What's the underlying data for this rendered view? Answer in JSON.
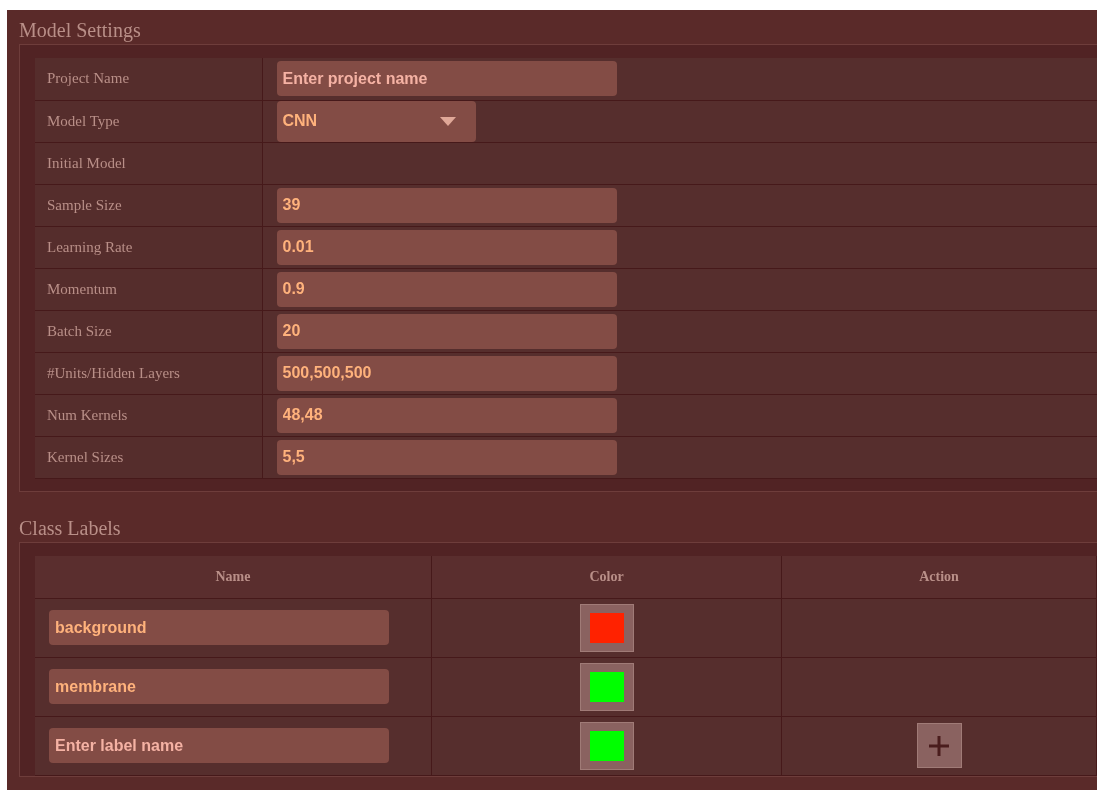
{
  "model_settings": {
    "title": "Model Settings",
    "fields": [
      {
        "label": "Project Name",
        "kind": "text",
        "placeholder": "Enter project name"
      },
      {
        "label": "Model Type",
        "kind": "select",
        "value": "CNN"
      },
      {
        "label": "Initial Model",
        "kind": "empty"
      },
      {
        "label": "Sample Size",
        "kind": "text",
        "value": "39"
      },
      {
        "label": "Learning Rate",
        "kind": "text",
        "value": "0.01"
      },
      {
        "label": "Momentum",
        "kind": "text",
        "value": "0.9"
      },
      {
        "label": "Batch Size",
        "kind": "text",
        "value": "20"
      },
      {
        "label": "#Units/Hidden Layers",
        "kind": "text",
        "value": "500,500,500"
      },
      {
        "label": "Num Kernels",
        "kind": "text",
        "value": "48,48"
      },
      {
        "label": "Kernel Sizes",
        "kind": "text",
        "value": "5,5"
      }
    ]
  },
  "class_labels": {
    "title": "Class Labels",
    "columns": [
      "Name",
      "Color",
      "Action"
    ],
    "rows": [
      {
        "value": "background",
        "color": "#ff2200"
      },
      {
        "value": "membrane",
        "color": "#00ff00"
      },
      {
        "placeholder": "Enter label name",
        "color": "#00ff00",
        "add_button": true
      }
    ]
  }
}
